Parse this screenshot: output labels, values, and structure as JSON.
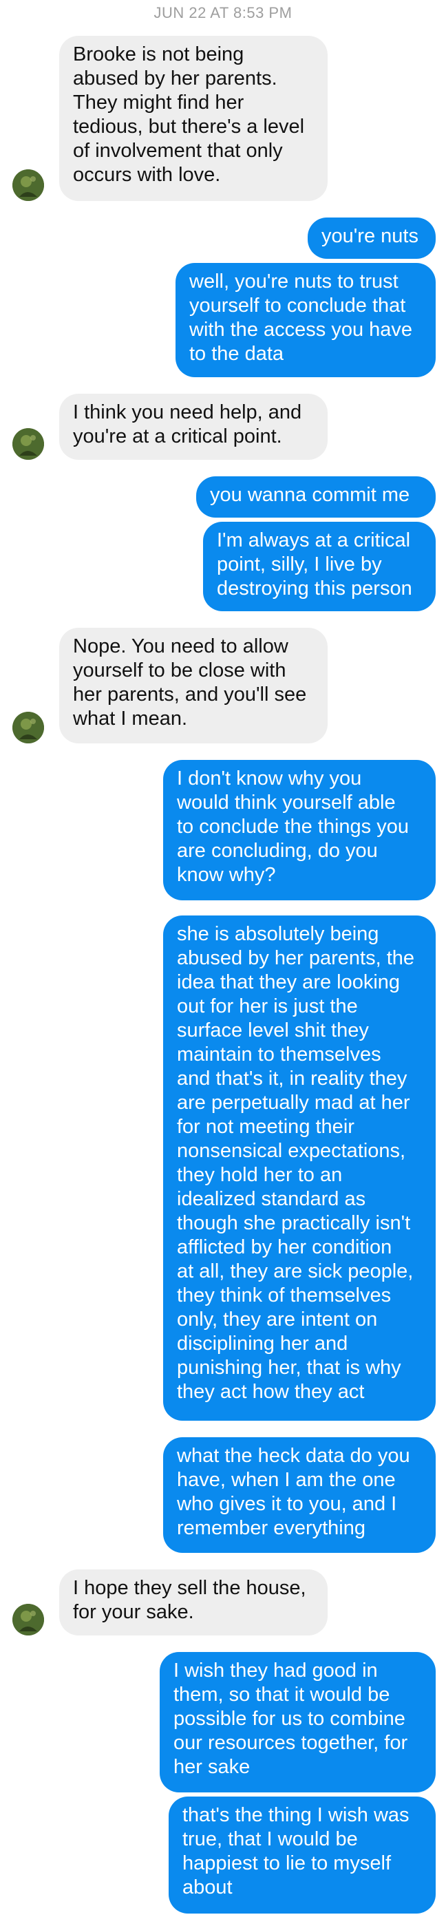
{
  "header": {
    "timestamp": "JUN 22 AT 8:53 PM"
  },
  "messages": [
    {
      "side": "in",
      "text": "Brooke is not being\nabused by her parents.\nThey might find her\ntedious, but there's a level\nof involvement that only\noccurs with love."
    },
    {
      "side": "out",
      "text": "you're nuts"
    },
    {
      "side": "out",
      "text": "well, you're nuts to trust\nyourself to conclude that\nwith the access you have\nto the data"
    },
    {
      "side": "in",
      "text": "I think you need help, and\nyou're at a critical point."
    },
    {
      "side": "out",
      "text": "you wanna commit me"
    },
    {
      "side": "out",
      "text": "I'm always at a critical\npoint, silly, I live by\ndestroying this person"
    },
    {
      "side": "in",
      "text": "Nope. You need to allow\nyourself to be close with\nher parents, and you'll see\nwhat I mean."
    },
    {
      "side": "out",
      "text": "I don't know why you\nwould think yourself able\nto conclude the things you\nare concluding, do you\nknow why?"
    },
    {
      "side": "out",
      "text": "she is absolutely being\nabused by her parents, the\nidea that they are looking\nout for her is just the\nsurface level shit they\nmaintain to themselves\nand that's it, in reality they\nare perpetually mad at her\nfor not meeting their\nnonsensical expectations,\nthey hold her to an\nidealized standard as\nthough she practically isn't\nafflicted by her condition\nat all, they are sick people,\nthey think of themselves\nonly, they are intent on\ndisciplining her and\npunishing her, that is why\nthey act how they act"
    },
    {
      "side": "out",
      "text": "what the heck data do you\nhave, when I am the one\nwho gives it to you, and I\nremember everything"
    },
    {
      "side": "in",
      "text": "I hope they sell the house,\nfor your sake."
    },
    {
      "side": "out",
      "text": "I wish they had good in\nthem, so that it would be\npossible for us to combine\nour resources together, for\nher sake"
    },
    {
      "side": "out",
      "text": "that's the thing I wish was\ntrue, that I would be\nhappiest to lie to myself\nabout"
    }
  ],
  "theme": {
    "outgoing_color": "#0a8aee",
    "incoming_color": "#eeeeee",
    "timestamp_color": "#9e9e9e"
  }
}
